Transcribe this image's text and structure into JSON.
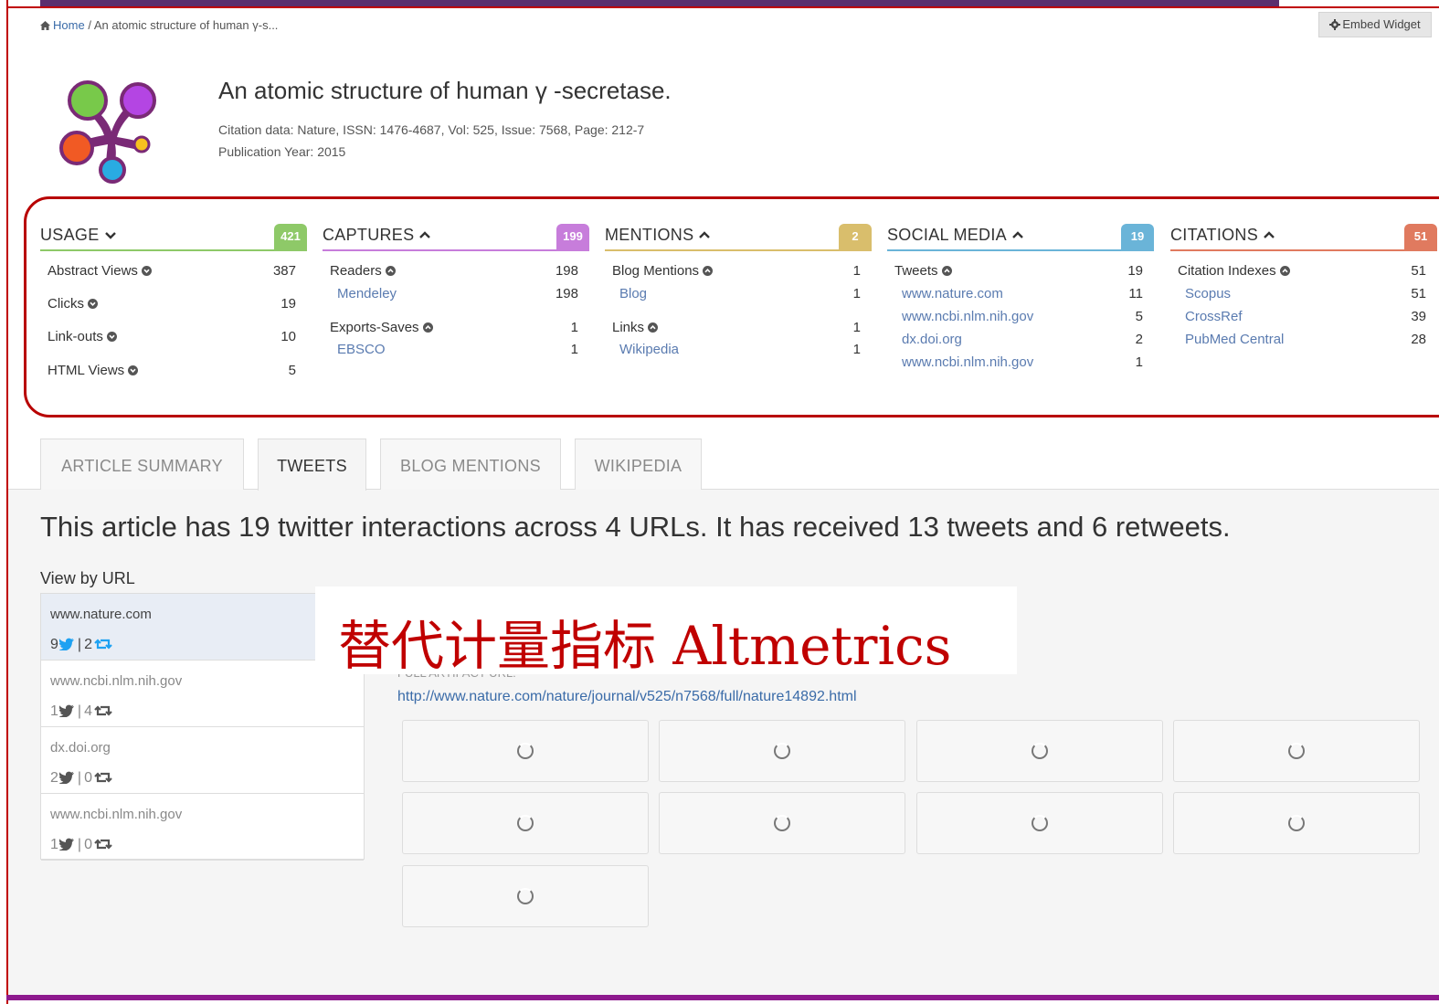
{
  "breadcrumb": {
    "home": "Home",
    "separator": "/",
    "current": "An atomic structure of human γ-s..."
  },
  "embed_widget": "Embed Widget",
  "article": {
    "title": "An atomic structure of human  γ -secretase.",
    "citation": "Citation data: Nature, ISSN: 1476-4687, Vol: 525, Issue: 7568, Page: 212-7",
    "publication_year": "Publication Year: 2015"
  },
  "metrics": {
    "usage": {
      "title": "USAGE",
      "badge": "421",
      "color": "#8ec968",
      "rows": [
        {
          "label": "Abstract Views",
          "value": "387"
        },
        {
          "label": "Clicks",
          "value": "19"
        },
        {
          "label": "Link-outs",
          "value": "10"
        },
        {
          "label": "HTML Views",
          "value": "5"
        }
      ]
    },
    "captures": {
      "title": "CAPTURES",
      "badge": "199",
      "color": "#c77ddb",
      "rows": [
        {
          "label": "Readers",
          "value": "198"
        },
        {
          "label": "Mendeley",
          "value": "198"
        },
        {
          "label": "Exports-Saves",
          "value": "1"
        },
        {
          "label": "EBSCO",
          "value": "1"
        }
      ]
    },
    "mentions": {
      "title": "MENTIONS",
      "badge": "2",
      "color": "#d9be6c",
      "rows": [
        {
          "label": "Blog Mentions",
          "value": "1"
        },
        {
          "label": "Blog",
          "value": "1"
        },
        {
          "label": "Links",
          "value": "1"
        },
        {
          "label": "Wikipedia",
          "value": "1"
        }
      ]
    },
    "social": {
      "title": "SOCIAL MEDIA",
      "badge": "19",
      "color": "#6ab4d8",
      "rows": [
        {
          "label": "Tweets",
          "value": "19"
        },
        {
          "label": "www.nature.com",
          "value": "11"
        },
        {
          "label": "www.ncbi.nlm.nih.gov",
          "value": "5"
        },
        {
          "label": "dx.doi.org",
          "value": "2"
        },
        {
          "label": "www.ncbi.nlm.nih.gov",
          "value": "1"
        }
      ]
    },
    "citations": {
      "title": "CITATIONS",
      "badge": "51",
      "color": "#e07a5f",
      "rows": [
        {
          "label": "Citation Indexes",
          "value": "51"
        },
        {
          "label": "Scopus",
          "value": "51"
        },
        {
          "label": "CrossRef",
          "value": "39"
        },
        {
          "label": "PubMed Central",
          "value": "28"
        }
      ]
    }
  },
  "tabs": [
    "ARTICLE SUMMARY",
    "TWEETS",
    "BLOG MENTIONS",
    "WIKIPEDIA"
  ],
  "active_tab": "TWEETS",
  "summary": "This article has 19 twitter interactions across 4 URLs. It has received 13 tweets and 6 retweets.",
  "view_by_label": "View by URL",
  "urls": [
    {
      "host": "www.nature.com",
      "tweets": "9",
      "retweets": "2"
    },
    {
      "host": "www.ncbi.nlm.nih.gov",
      "tweets": "1",
      "retweets": "4"
    },
    {
      "host": "dx.doi.org",
      "tweets": "2",
      "retweets": "0"
    },
    {
      "host": "www.ncbi.nlm.nih.gov",
      "tweets": "1",
      "retweets": "0"
    }
  ],
  "full_artifact_label": "FULL ARTIFACT URL:",
  "full_artifact_url": "http://www.nature.com/nature/journal/v525/n7568/full/nature14892.html",
  "overlay_caption": "替代计量指标 Altmetrics",
  "pipe": "|",
  "colors": {
    "frame": "#c00000",
    "link": "#3a6ba8",
    "twitter": "#1da1f2",
    "overlay_text": "#c00000"
  },
  "icons": {
    "home": "home-icon",
    "gear": "gear-icon",
    "info": "info-icon",
    "twitter": "twitter-bird-icon",
    "retweet": "retweet-icon",
    "loading": "spinner-icon"
  }
}
